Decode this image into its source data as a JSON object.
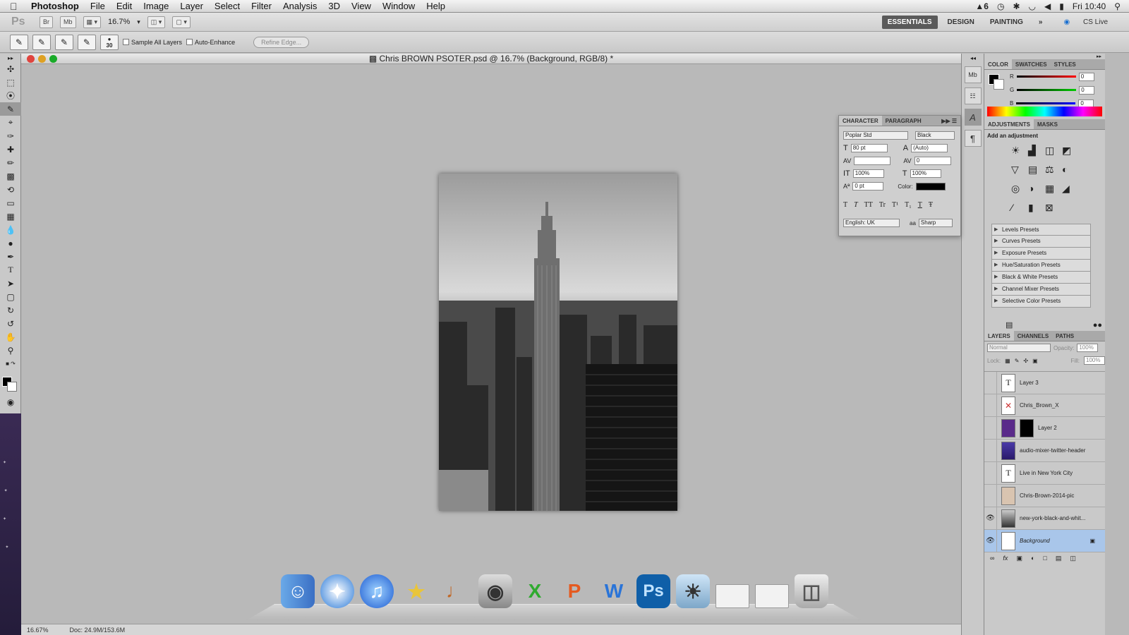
{
  "menubar": {
    "app": "Photoshop",
    "items": [
      "File",
      "Edit",
      "Image",
      "Layer",
      "Select",
      "Filter",
      "Analysis",
      "3D",
      "View",
      "Window",
      "Help"
    ],
    "status_num": "6",
    "clock": "Fri 10:40"
  },
  "appbar": {
    "logo": "Ps",
    "br": "Br",
    "mb": "Mb",
    "zoom": "16.7%",
    "workspaces": [
      "ESSENTIALS",
      "DESIGN",
      "PAINTING"
    ],
    "more": "»",
    "cslive": "CS Live"
  },
  "options": {
    "brush_size": "30",
    "sample_all_layers": "Sample All Layers",
    "auto_enhance": "Auto-Enhance",
    "refine_edge": "Refine Edge..."
  },
  "document": {
    "title": "Chris BROWN PSOTER.psd @ 16.7% (Background, RGB/8) *",
    "status_zoom": "16.67%",
    "status_doc": "Doc: 24.9M/153.6M"
  },
  "color_panel": {
    "tabs": [
      "COLOR",
      "SWATCHES",
      "STYLES"
    ],
    "channels": [
      {
        "label": "R",
        "value": "0",
        "color": "#d22"
      },
      {
        "label": "G",
        "value": "0",
        "color": "#2a2"
      },
      {
        "label": "B",
        "value": "0",
        "color": "#22c"
      }
    ]
  },
  "adjustments": {
    "tabs": [
      "ADJUSTMENTS",
      "MASKS"
    ],
    "heading": "Add an adjustment",
    "icons": [
      "☀",
      "▟",
      "◫",
      "◩",
      "▽",
      "▤",
      "⚖",
      "◐",
      "◎",
      "◑",
      "▦",
      "◢",
      "⁄",
      "▮",
      "⊠",
      "⬚"
    ],
    "presets": [
      "Levels Presets",
      "Curves Presets",
      "Exposure Presets",
      "Hue/Saturation Presets",
      "Black & White Presets",
      "Channel Mixer Presets",
      "Selective Color Presets"
    ]
  },
  "character": {
    "tabs": [
      "CHARACTER",
      "PARAGRAPH"
    ],
    "font": "Poplar Std",
    "style": "Black",
    "size": "80 pt",
    "leading": "(Auto)",
    "kerning": "",
    "tracking": "0",
    "vscale": "100%",
    "hscale": "100%",
    "baseline": "0 pt",
    "color_label": "Color:",
    "color": "#000000",
    "styles": [
      "T",
      "T",
      "TT",
      "Tr",
      "T¹",
      "T₁",
      "T",
      "Ŧ"
    ],
    "language": "English: UK",
    "aa_label": "aa",
    "antialias": "Sharp"
  },
  "layers": {
    "tabs": [
      "LAYERS",
      "CHANNELS",
      "PATHS"
    ],
    "blend": "Normal",
    "opacity_label": "Opacity:",
    "opacity": "100%",
    "lock_label": "Lock:",
    "fill_label": "Fill:",
    "fill": "100%",
    "items": [
      {
        "name": "Layer 3",
        "type": "text",
        "visible": false
      },
      {
        "name": "Chris_Brown_X",
        "type": "image",
        "visible": false
      },
      {
        "name": "Layer 2",
        "type": "image",
        "visible": false
      },
      {
        "name": "audio-mixer-twitter-header",
        "type": "image",
        "visible": false
      },
      {
        "name": "Live in New York City",
        "type": "text",
        "visible": false
      },
      {
        "name": "Chris-Brown-2014-pic",
        "type": "image",
        "visible": false
      },
      {
        "name": "new-york-black-and-whit...",
        "type": "image",
        "visible": true
      },
      {
        "name": "Background",
        "type": "bg",
        "visible": true
      }
    ]
  },
  "dock": {
    "apps": [
      "finder",
      "safari",
      "itunes",
      "imovie",
      "garageband",
      "disk-utility",
      "excel",
      "powerpoint",
      "word",
      "photoshop",
      "iphoto",
      "window-1",
      "window-2",
      "trash"
    ]
  }
}
